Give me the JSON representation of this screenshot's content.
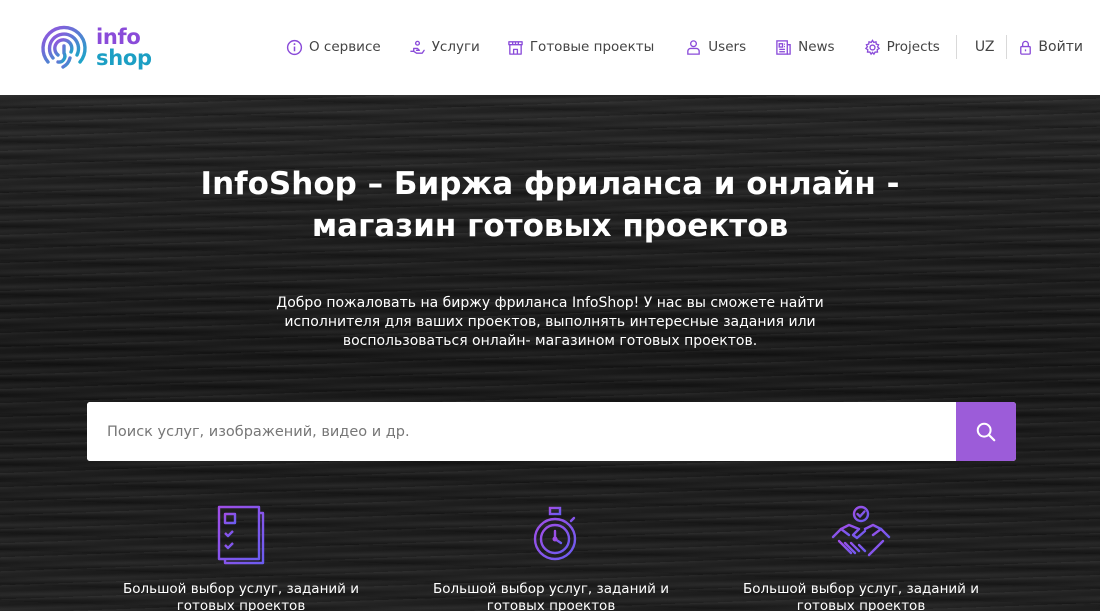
{
  "header": {
    "logo": {
      "line1": "info",
      "line2": "shop"
    },
    "nav": [
      {
        "label": "О сервисе",
        "icon": "info-circle-icon"
      },
      {
        "label": "Услуги",
        "icon": "hand-service-icon"
      },
      {
        "label": "Готовые проекты",
        "icon": "store-icon"
      },
      {
        "label": "Users",
        "icon": "users-icon"
      },
      {
        "label": "News",
        "icon": "newspaper-icon"
      },
      {
        "label": "Projects",
        "icon": "gear-icon"
      }
    ],
    "language": "UZ",
    "login": {
      "label": "Войти",
      "icon": "lock-icon"
    }
  },
  "hero": {
    "title": "InfoShop – Биржа фриланса и онлайн - магазин готовых проектов",
    "subtitle": "Добро пожаловать на биржу фриланса InfoShop! У нас вы сможете найти исполнителя для ваших проектов, выполнять интересные задания или воспользоваться онлайн- магазином готовых проектов.",
    "search": {
      "placeholder": "Поиск услуг, изображений, видео и др.",
      "value": ""
    }
  },
  "features": [
    {
      "text": "Большой выбор услуг, заданий и готовых проектов",
      "icon": "document-list-icon"
    },
    {
      "text": "Большой выбор услуг, заданий и готовых проектов",
      "icon": "stopwatch-icon"
    },
    {
      "text": "Большой выбор услуг, заданий и готовых проектов",
      "icon": "handshake-icon"
    }
  ],
  "colors": {
    "accent": "#9c5cd9",
    "logo_purple": "#8a4bd9",
    "logo_blue": "#1c9fc4",
    "hero_bg": "#1d1d1d"
  }
}
